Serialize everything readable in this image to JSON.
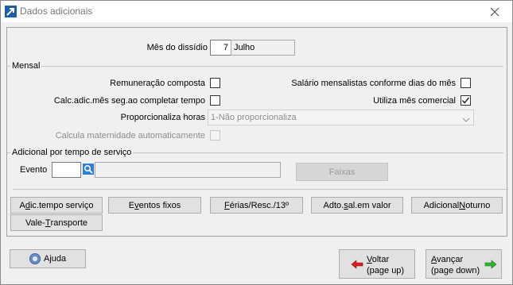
{
  "window": {
    "title": "Dados adicionais"
  },
  "top": {
    "mes_dissidio_label": "Mês do dissídio",
    "mes_dissidio_value": "7",
    "mes_dissidio_name": "Julho"
  },
  "mensal": {
    "group_label": "Mensal",
    "remuneracao_composta": {
      "label": "Remuneração composta",
      "checked": false
    },
    "salario_mensalistas": {
      "label": "Salário mensalistas conforme dias do mês",
      "checked": false
    },
    "calc_adic_mes": {
      "label": "Calc.adic.mês seg.ao completar tempo",
      "checked": false
    },
    "utiliza_mes_comercial": {
      "label": "Utiliza mês comercial",
      "checked": true
    },
    "proporcionaliza_horas": {
      "label": "Proporcionaliza horas",
      "value": "1-Não proporcionaliza"
    },
    "calcula_maternidade": {
      "label": "Calcula maternidade automaticamente",
      "checked": false
    }
  },
  "adicional": {
    "group_label": "Adicional por tempo de serviço",
    "evento_label": "Evento",
    "evento_value": "",
    "evento_desc": "",
    "faixas_label": "Faixas"
  },
  "buttons": {
    "adic_tempo": {
      "pre": "A",
      "u": "d",
      "post": "ic.tempo serviço"
    },
    "eventos_fixos": {
      "pre": "E",
      "u": "v",
      "post": "entos fixos"
    },
    "ferias": {
      "pre": "",
      "u": "F",
      "post": "érias/Resc./13º"
    },
    "adto_sal": {
      "pre": "Adto.",
      "u": "s",
      "post": "al.em valor"
    },
    "adicional_noturno": {
      "pre": "Adicional ",
      "u": "N",
      "post": "oturno"
    },
    "vale_transporte": {
      "pre": "Vale-",
      "u": "T",
      "post": "ransporte"
    }
  },
  "footer": {
    "ajuda": {
      "pre": "A",
      "u": "j",
      "post": "uda"
    },
    "voltar": {
      "u": "V",
      "post": "oltar",
      "line2": "(page up)"
    },
    "avancar": {
      "u": "A",
      "post": "vançar",
      "line2": "(page down)"
    }
  }
}
